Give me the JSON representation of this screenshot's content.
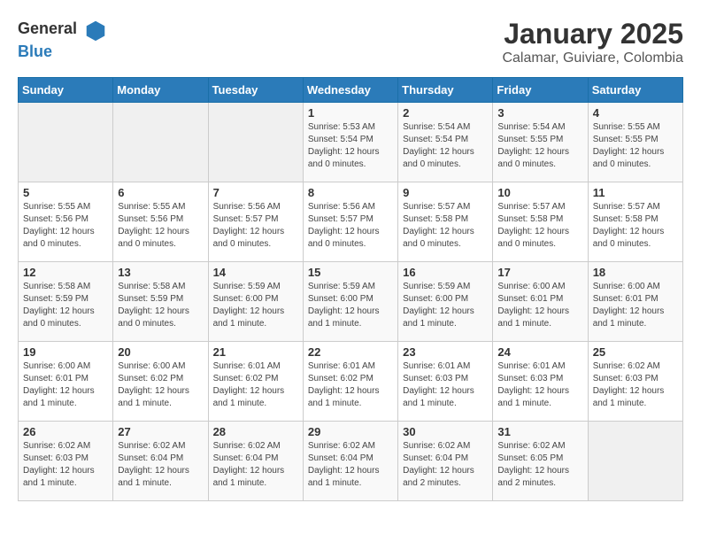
{
  "header": {
    "logo_general": "General",
    "logo_blue": "Blue",
    "title": "January 2025",
    "subtitle": "Calamar, Guiviare, Colombia"
  },
  "weekdays": [
    "Sunday",
    "Monday",
    "Tuesday",
    "Wednesday",
    "Thursday",
    "Friday",
    "Saturday"
  ],
  "weeks": [
    [
      {
        "day": "",
        "sunrise": "",
        "sunset": "",
        "daylight": "",
        "empty": true
      },
      {
        "day": "",
        "sunrise": "",
        "sunset": "",
        "daylight": "",
        "empty": true
      },
      {
        "day": "",
        "sunrise": "",
        "sunset": "",
        "daylight": "",
        "empty": true
      },
      {
        "day": "1",
        "sunrise": "Sunrise: 5:53 AM",
        "sunset": "Sunset: 5:54 PM",
        "daylight": "Daylight: 12 hours and 0 minutes."
      },
      {
        "day": "2",
        "sunrise": "Sunrise: 5:54 AM",
        "sunset": "Sunset: 5:54 PM",
        "daylight": "Daylight: 12 hours and 0 minutes."
      },
      {
        "day": "3",
        "sunrise": "Sunrise: 5:54 AM",
        "sunset": "Sunset: 5:55 PM",
        "daylight": "Daylight: 12 hours and 0 minutes."
      },
      {
        "day": "4",
        "sunrise": "Sunrise: 5:55 AM",
        "sunset": "Sunset: 5:55 PM",
        "daylight": "Daylight: 12 hours and 0 minutes."
      }
    ],
    [
      {
        "day": "5",
        "sunrise": "Sunrise: 5:55 AM",
        "sunset": "Sunset: 5:56 PM",
        "daylight": "Daylight: 12 hours and 0 minutes."
      },
      {
        "day": "6",
        "sunrise": "Sunrise: 5:55 AM",
        "sunset": "Sunset: 5:56 PM",
        "daylight": "Daylight: 12 hours and 0 minutes."
      },
      {
        "day": "7",
        "sunrise": "Sunrise: 5:56 AM",
        "sunset": "Sunset: 5:57 PM",
        "daylight": "Daylight: 12 hours and 0 minutes."
      },
      {
        "day": "8",
        "sunrise": "Sunrise: 5:56 AM",
        "sunset": "Sunset: 5:57 PM",
        "daylight": "Daylight: 12 hours and 0 minutes."
      },
      {
        "day": "9",
        "sunrise": "Sunrise: 5:57 AM",
        "sunset": "Sunset: 5:58 PM",
        "daylight": "Daylight: 12 hours and 0 minutes."
      },
      {
        "day": "10",
        "sunrise": "Sunrise: 5:57 AM",
        "sunset": "Sunset: 5:58 PM",
        "daylight": "Daylight: 12 hours and 0 minutes."
      },
      {
        "day": "11",
        "sunrise": "Sunrise: 5:57 AM",
        "sunset": "Sunset: 5:58 PM",
        "daylight": "Daylight: 12 hours and 0 minutes."
      }
    ],
    [
      {
        "day": "12",
        "sunrise": "Sunrise: 5:58 AM",
        "sunset": "Sunset: 5:59 PM",
        "daylight": "Daylight: 12 hours and 0 minutes."
      },
      {
        "day": "13",
        "sunrise": "Sunrise: 5:58 AM",
        "sunset": "Sunset: 5:59 PM",
        "daylight": "Daylight: 12 hours and 0 minutes."
      },
      {
        "day": "14",
        "sunrise": "Sunrise: 5:59 AM",
        "sunset": "Sunset: 6:00 PM",
        "daylight": "Daylight: 12 hours and 1 minute."
      },
      {
        "day": "15",
        "sunrise": "Sunrise: 5:59 AM",
        "sunset": "Sunset: 6:00 PM",
        "daylight": "Daylight: 12 hours and 1 minute."
      },
      {
        "day": "16",
        "sunrise": "Sunrise: 5:59 AM",
        "sunset": "Sunset: 6:00 PM",
        "daylight": "Daylight: 12 hours and 1 minute."
      },
      {
        "day": "17",
        "sunrise": "Sunrise: 6:00 AM",
        "sunset": "Sunset: 6:01 PM",
        "daylight": "Daylight: 12 hours and 1 minute."
      },
      {
        "day": "18",
        "sunrise": "Sunrise: 6:00 AM",
        "sunset": "Sunset: 6:01 PM",
        "daylight": "Daylight: 12 hours and 1 minute."
      }
    ],
    [
      {
        "day": "19",
        "sunrise": "Sunrise: 6:00 AM",
        "sunset": "Sunset: 6:01 PM",
        "daylight": "Daylight: 12 hours and 1 minute."
      },
      {
        "day": "20",
        "sunrise": "Sunrise: 6:00 AM",
        "sunset": "Sunset: 6:02 PM",
        "daylight": "Daylight: 12 hours and 1 minute."
      },
      {
        "day": "21",
        "sunrise": "Sunrise: 6:01 AM",
        "sunset": "Sunset: 6:02 PM",
        "daylight": "Daylight: 12 hours and 1 minute."
      },
      {
        "day": "22",
        "sunrise": "Sunrise: 6:01 AM",
        "sunset": "Sunset: 6:02 PM",
        "daylight": "Daylight: 12 hours and 1 minute."
      },
      {
        "day": "23",
        "sunrise": "Sunrise: 6:01 AM",
        "sunset": "Sunset: 6:03 PM",
        "daylight": "Daylight: 12 hours and 1 minute."
      },
      {
        "day": "24",
        "sunrise": "Sunrise: 6:01 AM",
        "sunset": "Sunset: 6:03 PM",
        "daylight": "Daylight: 12 hours and 1 minute."
      },
      {
        "day": "25",
        "sunrise": "Sunrise: 6:02 AM",
        "sunset": "Sunset: 6:03 PM",
        "daylight": "Daylight: 12 hours and 1 minute."
      }
    ],
    [
      {
        "day": "26",
        "sunrise": "Sunrise: 6:02 AM",
        "sunset": "Sunset: 6:03 PM",
        "daylight": "Daylight: 12 hours and 1 minute."
      },
      {
        "day": "27",
        "sunrise": "Sunrise: 6:02 AM",
        "sunset": "Sunset: 6:04 PM",
        "daylight": "Daylight: 12 hours and 1 minute."
      },
      {
        "day": "28",
        "sunrise": "Sunrise: 6:02 AM",
        "sunset": "Sunset: 6:04 PM",
        "daylight": "Daylight: 12 hours and 1 minute."
      },
      {
        "day": "29",
        "sunrise": "Sunrise: 6:02 AM",
        "sunset": "Sunset: 6:04 PM",
        "daylight": "Daylight: 12 hours and 1 minute."
      },
      {
        "day": "30",
        "sunrise": "Sunrise: 6:02 AM",
        "sunset": "Sunset: 6:04 PM",
        "daylight": "Daylight: 12 hours and 2 minutes."
      },
      {
        "day": "31",
        "sunrise": "Sunrise: 6:02 AM",
        "sunset": "Sunset: 6:05 PM",
        "daylight": "Daylight: 12 hours and 2 minutes."
      },
      {
        "day": "",
        "sunrise": "",
        "sunset": "",
        "daylight": "",
        "empty": true
      }
    ]
  ]
}
